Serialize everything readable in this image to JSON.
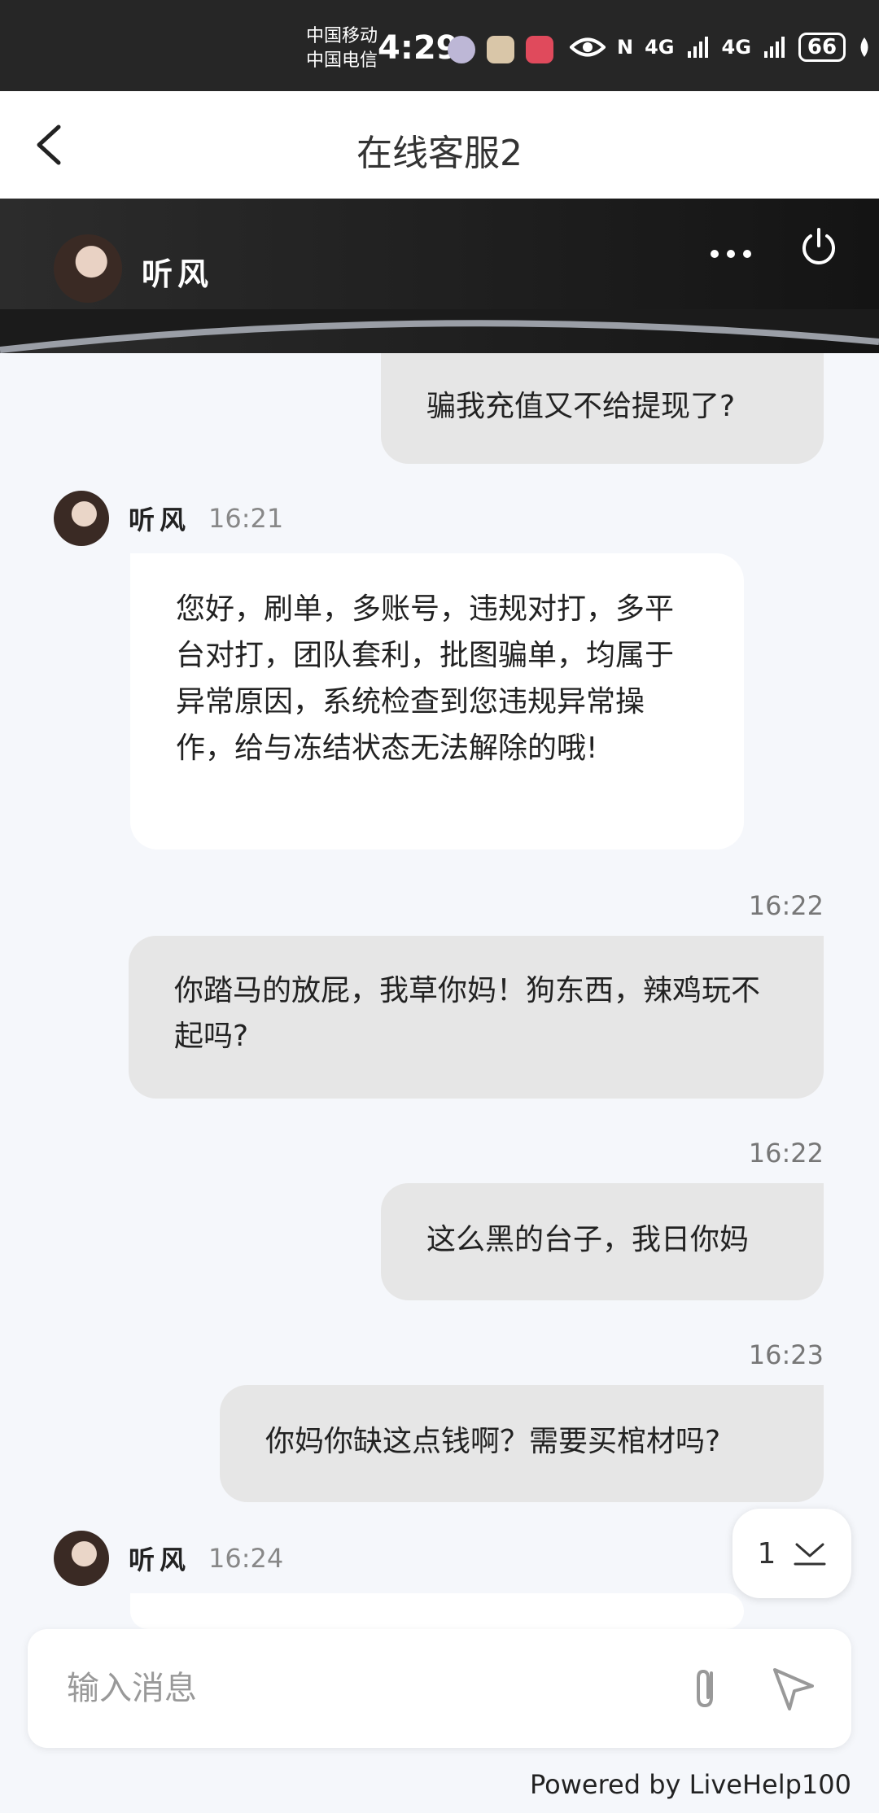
{
  "status_bar": {
    "carrier_1": "中国移动",
    "carrier_2": "中国电信",
    "time": "4:29",
    "network_1": "4G",
    "network_2": "4G",
    "battery": "66"
  },
  "header": {
    "title": "在线客服2"
  },
  "agent": {
    "name": "听风"
  },
  "messages": [
    {
      "type": "out",
      "text": "骗我充值又不给提现了?"
    },
    {
      "type": "in",
      "sender": "听风",
      "time": "16:21",
      "text": "您好，刷单，多账号，违规对打，多平台对打，团队套利，批图骗单，均属于异常原因，系统检查到您违规异常操作，给与冻结状态无法解除的哦!"
    },
    {
      "type": "out",
      "time": "16:22",
      "text": "你踏马的放屁，我草你妈！狗东西，辣鸡玩不起吗?"
    },
    {
      "type": "out",
      "time": "16:22",
      "text": "这么黑的台子，我日你妈"
    },
    {
      "type": "out",
      "time": "16:23",
      "text": "你妈你缺这点钱啊？需要买棺材吗?"
    },
    {
      "type": "in",
      "sender": "听风",
      "time": "16:24",
      "text": ""
    }
  ],
  "scroll_badge": {
    "count": "1"
  },
  "input": {
    "placeholder": "输入消息"
  },
  "footer": {
    "powered": "Powered by LiveHelp100"
  }
}
